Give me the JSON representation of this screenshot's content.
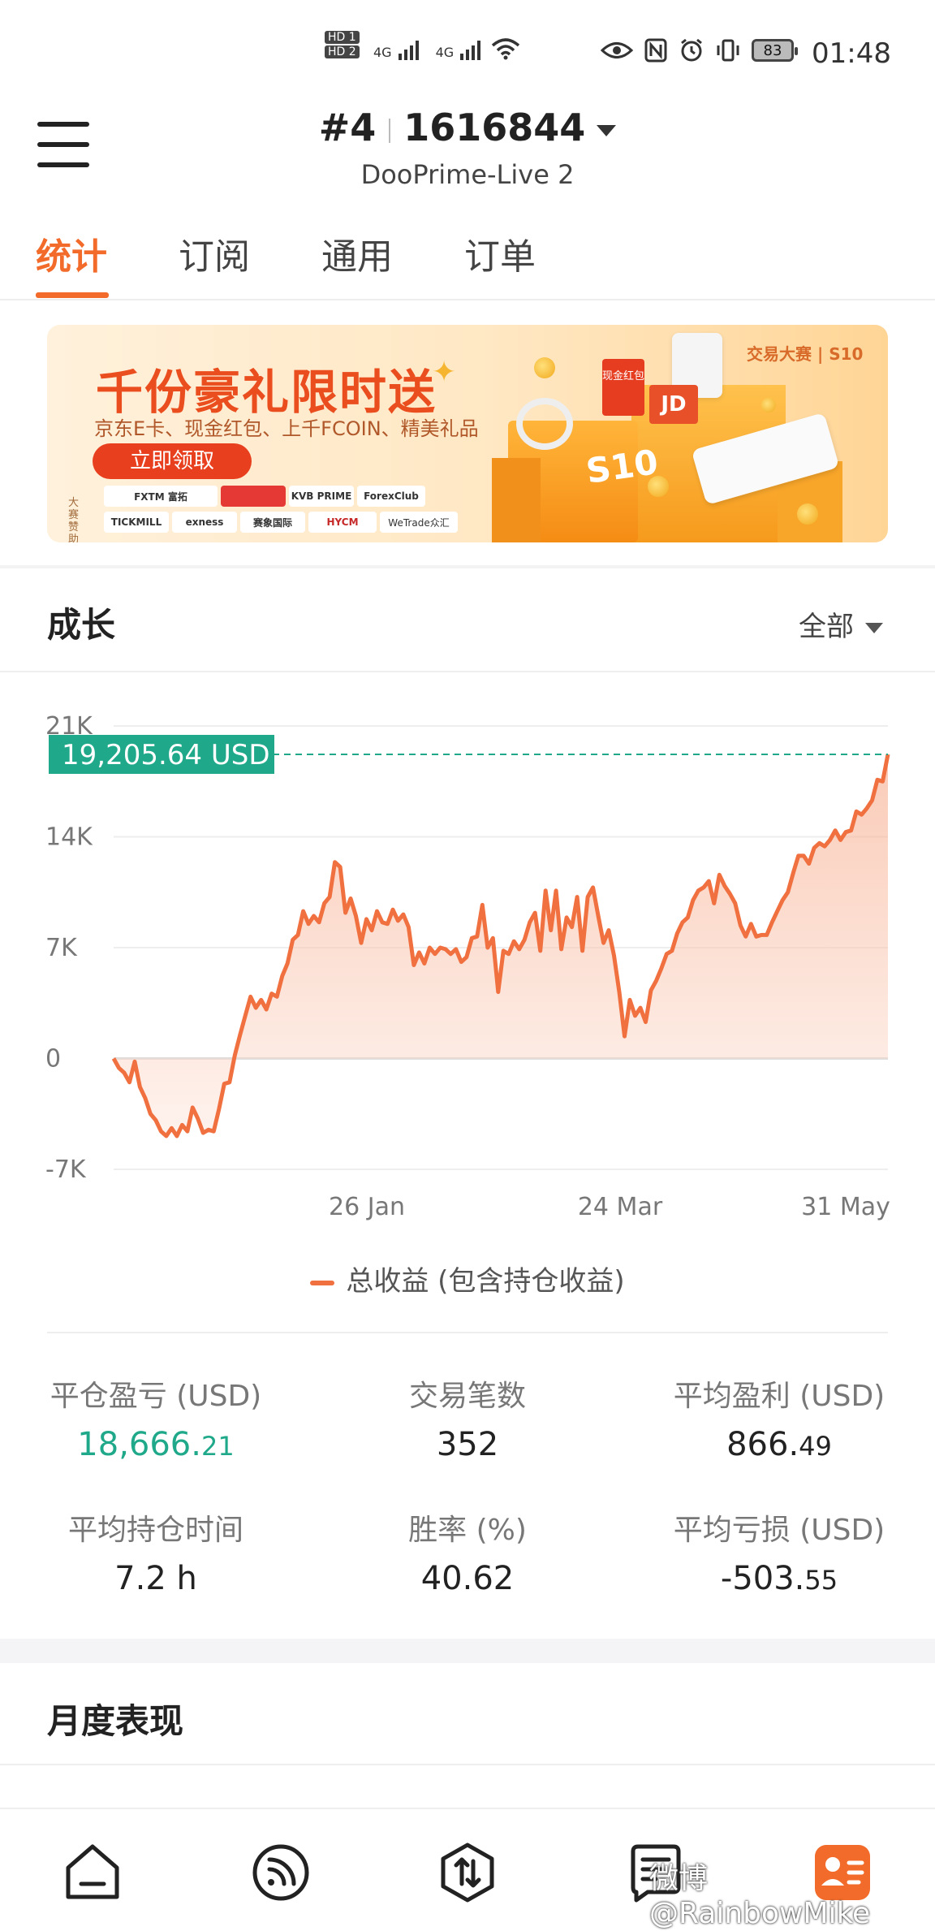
{
  "status_bar": {
    "sim1": "HD 1",
    "sim2": "HD 2",
    "net1": "4G",
    "net2": "4G",
    "battery": "83",
    "time": "01:48"
  },
  "header": {
    "account_no": "#4",
    "account_id": "1616844",
    "server": "DooPrime-Live 2"
  },
  "tabs": [
    {
      "label": "统计",
      "active": true
    },
    {
      "label": "订阅",
      "active": false
    },
    {
      "label": "通用",
      "active": false
    },
    {
      "label": "订单",
      "active": false
    }
  ],
  "banner": {
    "title": "千份豪礼限时送",
    "subtitle": "京东E卡、现金红包、上千FCOIN、精美礼品",
    "button": "立即领取",
    "sponsor_label": "大赛赞助",
    "brand": "交易大赛 | S10",
    "gift_label": "现金红包",
    "id_label": "JD",
    "season": "S10",
    "sponsors": [
      "FXTM 富拓",
      "",
      "KVB PRIME",
      "ForexClub",
      "TICKMILL",
      "exness",
      "赛象国际",
      "HYCM",
      "WeTrade众汇"
    ]
  },
  "growth": {
    "title": "成长",
    "filter": "全部",
    "current_value": "19,205.64 USD",
    "legend": "总收益 (包含持仓收益)"
  },
  "chart_data": {
    "type": "area",
    "title": "",
    "xlabel": "",
    "ylabel": "",
    "y_ticks": [
      "21K",
      "14K",
      "7K",
      "0",
      "-7K"
    ],
    "x_ticks": [
      "26 Jan",
      "24 Mar",
      "31 May"
    ],
    "ylim": [
      -7000,
      21000
    ],
    "series": [
      {
        "name": "总收益 (包含持仓收益)",
        "color": "#f07040",
        "values": [
          0,
          -600,
          -900,
          -1500,
          -200,
          -1800,
          -2500,
          -3500,
          -3900,
          -4600,
          -4900,
          -4400,
          -4900,
          -4200,
          -4600,
          -3100,
          -3800,
          -4700,
          -4500,
          -4600,
          -3200,
          -1600,
          -1500,
          200,
          1500,
          2700,
          3900,
          3200,
          3700,
          3100,
          4100,
          3900,
          5200,
          6000,
          7500,
          7800,
          9300,
          8500,
          9000,
          8600,
          9800,
          10200,
          12400,
          12100,
          9200,
          10100,
          9000,
          7300,
          8800,
          8100,
          9300,
          8600,
          8500,
          9400,
          8700,
          9100,
          8300,
          5900,
          6700,
          6000,
          7000,
          6600,
          7000,
          6900,
          6600,
          6900,
          6100,
          6400,
          7600,
          7700,
          9700,
          7000,
          7600,
          4200,
          6800,
          6600,
          7400,
          6900,
          7500,
          8600,
          9200,
          6800,
          10600,
          8100,
          10600,
          6900,
          8900,
          8300,
          10200,
          6800,
          10200,
          10800,
          9000,
          7300,
          8100,
          6500,
          4200,
          1400,
          3700,
          2700,
          3200,
          2300,
          4300,
          4900,
          5700,
          6600,
          6800,
          7900,
          8600,
          8900,
          10000,
          10600,
          10800,
          11200,
          9800,
          11600,
          10900,
          10400,
          9800,
          8400,
          7700,
          8500,
          7700,
          7800,
          7800,
          8600,
          9300,
          10000,
          10500,
          11700,
          12800,
          12800,
          12300,
          13300,
          13600,
          13400,
          13800,
          14400,
          13800,
          14300,
          14400,
          15600,
          15400,
          15800,
          16300,
          17600,
          17500,
          19205.64
        ]
      }
    ]
  },
  "stats": [
    {
      "label": "平仓盈亏 (USD)",
      "int": "18,666.",
      "dec": "21",
      "green": true
    },
    {
      "label": "交易笔数",
      "int": "352",
      "dec": "",
      "green": false
    },
    {
      "label": "平均盈利 (USD)",
      "int": "866.",
      "dec": "49",
      "green": false
    },
    {
      "label": "平均持仓时间",
      "int": "7.2 h",
      "dec": "",
      "green": false
    },
    {
      "label": "胜率 (%)",
      "int": "40.62",
      "dec": "",
      "green": false
    },
    {
      "label": "平均亏损 (USD)",
      "int": "-503.",
      "dec": "55",
      "green": false
    }
  ],
  "monthly": {
    "title": "月度表现"
  },
  "bottom_nav": {
    "items": [
      "home-icon",
      "subscribe-icon",
      "trade-icon",
      "orders-icon",
      "profile-icon"
    ]
  },
  "watermark": "微博 @RainbowMike"
}
